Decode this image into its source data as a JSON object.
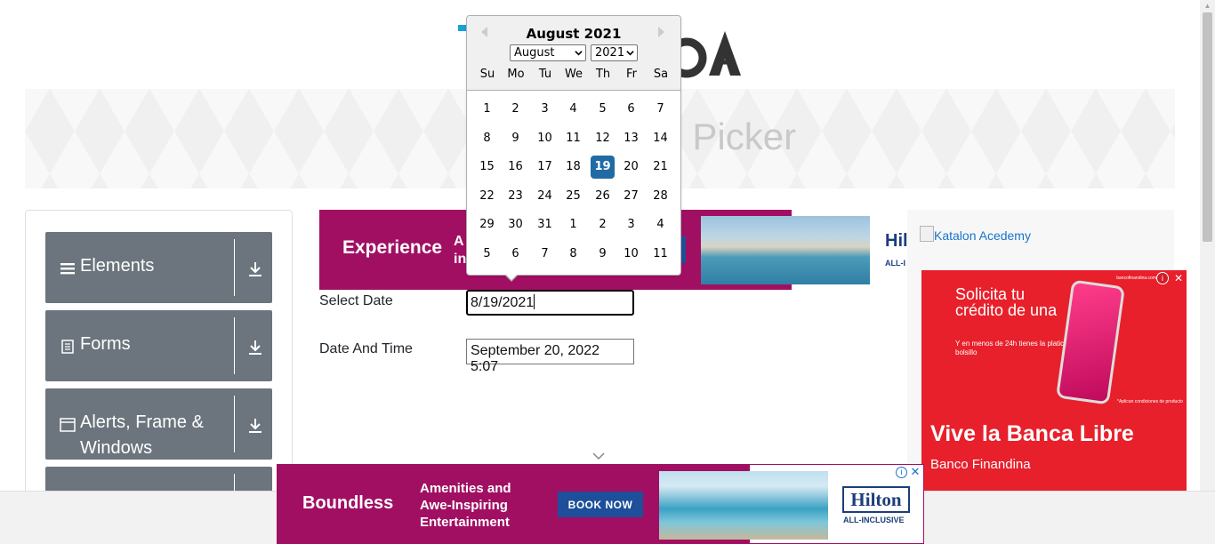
{
  "header": {
    "logo_text": "TOOLSQA",
    "banner_title": "Date Picker"
  },
  "nav": {
    "groups": [
      {
        "label": "Elements",
        "icon": "hamburger-icon"
      },
      {
        "label": "Forms",
        "icon": "document-icon"
      },
      {
        "label": "Alerts, Frame & Windows",
        "icon": "window-icon"
      },
      {
        "label": "",
        "icon": ""
      }
    ]
  },
  "ad_top": {
    "headline": "Experience",
    "fragment_line1": "A",
    "fragment_line2": "in",
    "brand": "Hil",
    "sub": "ALL-I"
  },
  "form": {
    "select_date_label": "Select Date",
    "select_date_value": "8/19/2021",
    "date_time_label": "Date And Time",
    "date_time_value": "September 20, 2022 5:07"
  },
  "datepicker": {
    "title": "August 2021",
    "month_select": "August",
    "year_select": "2021",
    "days_of_week": [
      "Su",
      "Mo",
      "Tu",
      "We",
      "Th",
      "Fr",
      "Sa"
    ],
    "weeks": [
      [
        "1",
        "2",
        "3",
        "4",
        "5",
        "6",
        "7"
      ],
      [
        "8",
        "9",
        "10",
        "11",
        "12",
        "13",
        "14"
      ],
      [
        "15",
        "16",
        "17",
        "18",
        "19",
        "20",
        "21"
      ],
      [
        "22",
        "23",
        "24",
        "25",
        "26",
        "27",
        "28"
      ],
      [
        "29",
        "30",
        "31",
        "1",
        "2",
        "3",
        "4"
      ],
      [
        "5",
        "6",
        "7",
        "8",
        "9",
        "10",
        "11"
      ]
    ],
    "selected_day": "19",
    "accent_color": "#216ba5"
  },
  "right_ad": {
    "link_text": "Katalon Acedemy",
    "domain": "bancofinandina.com",
    "headline": "Solicita tu crédito de una",
    "sub": "Y en menos de 24h tienes la platica en tu bolsillo",
    "fine": "*Aplican condiciones de producto",
    "big": "Vive la Banca Libre",
    "brand": "Banco Finandina"
  },
  "bottom_ad": {
    "headline": "Boundless",
    "tagline": "Amenities and Awe-Inspiring Entertainment",
    "cta": "BOOK NOW",
    "brand": "Hilton",
    "sub": "ALL-INCLUSIVE"
  },
  "colors": {
    "nav_bg": "#6c757d",
    "ad_magenta": "#a10f63",
    "bank_red": "#e8202b",
    "hilton_blue": "#1c3e7a"
  }
}
